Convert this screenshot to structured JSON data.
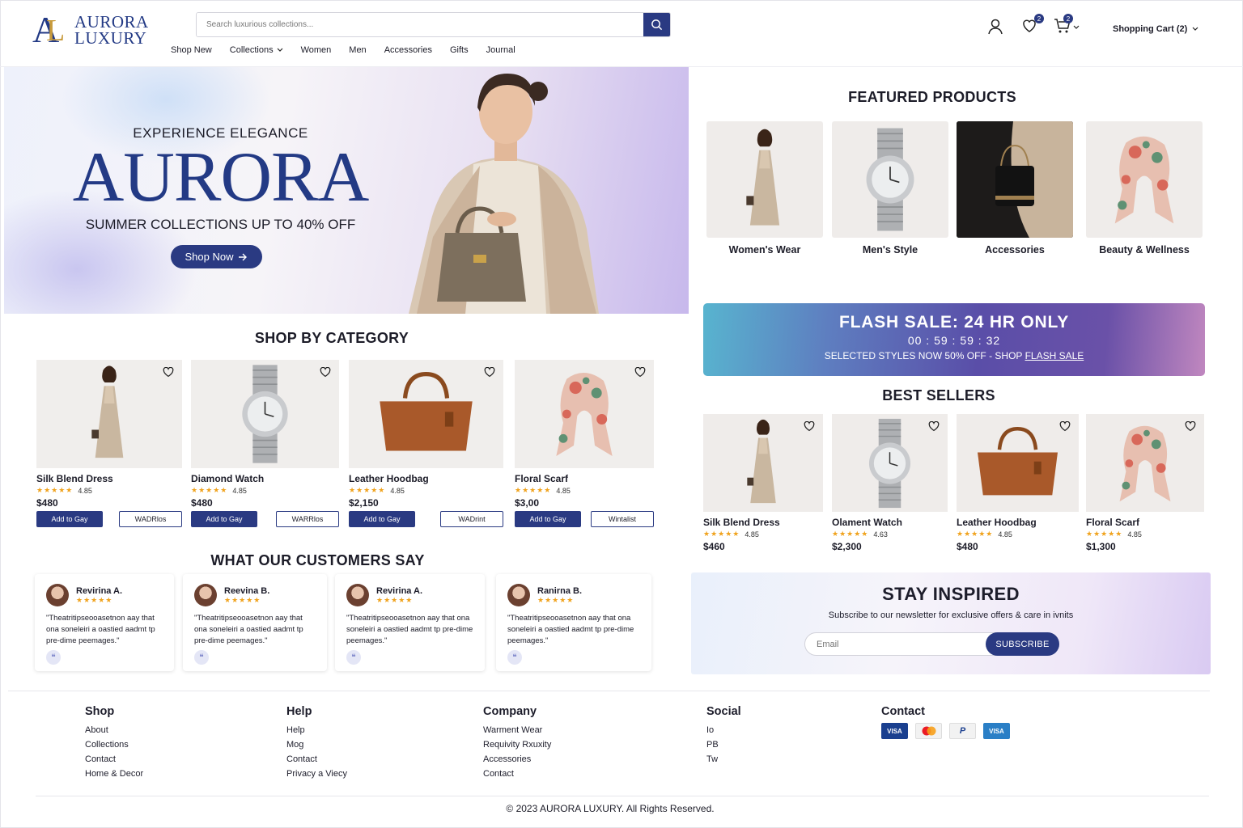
{
  "brand": {
    "line1": "AURORA",
    "line2": "LUXURY",
    "mark_a": "A",
    "mark_l": "L"
  },
  "search": {
    "placeholder": "Search luxurious collections..."
  },
  "nav": [
    "Shop New",
    "Collections",
    "Women",
    "Men",
    "Accessories",
    "Gifts",
    "Journal"
  ],
  "header": {
    "wishlist_count": "2",
    "cart_count": "2",
    "cart_label": "Shopping Cart (2)"
  },
  "hero": {
    "kicker": "EXPERIENCE ELEGANCE",
    "title": "AURORA",
    "subtitle": "SUMMER COLLECTIONS UP TO 40% OFF",
    "button": "Shop Now"
  },
  "category": {
    "heading": "SHOP BY CATEGORY",
    "items": [
      {
        "name": "Silk Blend Dress",
        "rating": "4.85",
        "price": "$480",
        "primary": "Add to Gay",
        "secondary": "WADRlos"
      },
      {
        "name": "Diamond Watch",
        "rating": "4.85",
        "price": "$480",
        "primary": "Add to Gay",
        "secondary": "WARRlos"
      },
      {
        "name": "Leather Hoodbag",
        "rating": "4.85",
        "price": "$2,150",
        "primary": "Add to Gay",
        "secondary": "WADrint"
      },
      {
        "name": "Floral Scarf",
        "rating": "4.85",
        "price": "$3,00",
        "primary": "Add to Gay",
        "secondary": "Wintalist"
      }
    ]
  },
  "testimonials": {
    "heading": "WHAT OUR CUSTOMERS SAY",
    "items": [
      {
        "name": "Revirina A.",
        "quote": "\"Theatritipseooasetnon aay that ona soneleiri a oastied aadmt tp pre-dime peemages.\""
      },
      {
        "name": "Reevina B.",
        "quote": "\"Theatritipseooasetnon aay that ona soneleiri a oastied aadmt tp pre-dime peemages.\""
      },
      {
        "name": "Revirina A.",
        "quote": "\"Theatritipseooasetnon aay that ona soneleiri a oastied aadmt tp pre-dime peemages.\""
      },
      {
        "name": "Ranirna B.",
        "quote": "\"Theatritipseooasetnon aay that ona soneleiri a oastied aadmt tp pre-dime peemages.\""
      }
    ],
    "stars": "★★★★★",
    "quote_icon": "❝"
  },
  "featured": {
    "heading": "FEATURED PRODUCTS",
    "items": [
      "Women's Wear",
      "Men's Style",
      "Accessories",
      "Beauty & Wellness"
    ]
  },
  "flash": {
    "title": "FLASH SALE: 24 HR ONLY",
    "timer": "00 : 59 : 59 : 32",
    "text": "SELECTED STYLES NOW 50% OFF - SHOP",
    "link": "FLASH SALE"
  },
  "bestsellers": {
    "heading": "BEST SELLERS",
    "items": [
      {
        "name": "Silk Blend Dress",
        "rating": "4.85",
        "price": "$460"
      },
      {
        "name": "Olament Watch",
        "rating": "4.63",
        "price": "$2,300"
      },
      {
        "name": "Leather Hoodbag",
        "rating": "4.85",
        "price": "$480"
      },
      {
        "name": "Floral Scarf",
        "rating": "4.85",
        "price": "$1,300"
      }
    ]
  },
  "newsletter": {
    "heading": "STAY INSPIRED",
    "text": "Subscribe to our newsletter for exclusive offers & care in ivnits",
    "placeholder": "Email",
    "button": "SUBSCRIBE"
  },
  "footer": {
    "shop": {
      "title": "Shop",
      "links": [
        "About",
        "Collections",
        "Contact",
        "Home & Decor"
      ]
    },
    "help": {
      "title": "Help",
      "links": [
        "Help",
        "Mog",
        "Contact",
        "Privacy a Viecy"
      ]
    },
    "company": {
      "title": "Company",
      "links": [
        "Warment Wear",
        "Requivity Rxuxity",
        "Accessories",
        "Contact"
      ]
    },
    "social": {
      "title": "Social",
      "links": [
        "Io",
        "PB",
        "Tw"
      ]
    },
    "contact": {
      "title": "Contact",
      "payments": [
        "VISA",
        "Mastercard",
        "PayPal",
        "VISA"
      ]
    },
    "copyright": "© 2023 AURORA LUXURY. All Rights Reserved."
  },
  "colors": {
    "brand_navy": "#2a3a82",
    "gold": "#c79a3b",
    "star": "#f0a31e"
  }
}
